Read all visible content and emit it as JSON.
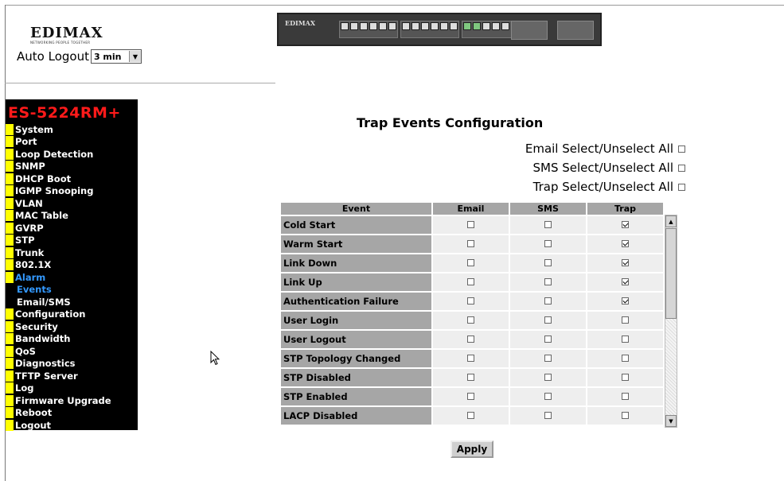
{
  "header": {
    "logo_text": "EDIMAX",
    "logo_tagline": "NETWORKING PEOPLE TOGETHER",
    "auto_logout_label": "Auto Logout",
    "auto_logout_value": "3 min",
    "device_brand": "EDIMAX"
  },
  "sidebar": {
    "model": "ES-5224RM+",
    "items": [
      {
        "label": "System"
      },
      {
        "label": "Port"
      },
      {
        "label": "Loop Detection"
      },
      {
        "label": "SNMP"
      },
      {
        "label": "DHCP Boot"
      },
      {
        "label": "IGMP Snooping"
      },
      {
        "label": "VLAN"
      },
      {
        "label": "MAC Table"
      },
      {
        "label": "GVRP"
      },
      {
        "label": "STP"
      },
      {
        "label": "Trunk"
      },
      {
        "label": "802.1X"
      },
      {
        "label": "Alarm"
      },
      {
        "label": "Events"
      },
      {
        "label": "Email/SMS"
      },
      {
        "label": "Configuration"
      },
      {
        "label": "Security"
      },
      {
        "label": "Bandwidth"
      },
      {
        "label": "QoS"
      },
      {
        "label": "Diagnostics"
      },
      {
        "label": "TFTP Server"
      },
      {
        "label": "Log"
      },
      {
        "label": "Firmware Upgrade"
      },
      {
        "label": "Reboot"
      },
      {
        "label": "Logout"
      }
    ]
  },
  "main": {
    "title": "Trap Events Configuration",
    "email_select_all": "Email Select/Unselect All",
    "sms_select_all": "SMS Select/Unselect All",
    "trap_select_all": "Trap Select/Unselect All",
    "columns": [
      "Event",
      "Email",
      "SMS",
      "Trap"
    ],
    "rows": [
      {
        "event": "Cold Start",
        "email": false,
        "sms": false,
        "trap": true
      },
      {
        "event": "Warm Start",
        "email": false,
        "sms": false,
        "trap": true
      },
      {
        "event": "Link Down",
        "email": false,
        "sms": false,
        "trap": true
      },
      {
        "event": "Link Up",
        "email": false,
        "sms": false,
        "trap": true
      },
      {
        "event": "Authentication Failure",
        "email": false,
        "sms": false,
        "trap": true
      },
      {
        "event": "User Login",
        "email": false,
        "sms": false,
        "trap": false
      },
      {
        "event": "User Logout",
        "email": false,
        "sms": false,
        "trap": false
      },
      {
        "event": "STP Topology Changed",
        "email": false,
        "sms": false,
        "trap": false
      },
      {
        "event": "STP Disabled",
        "email": false,
        "sms": false,
        "trap": false
      },
      {
        "event": "STP Enabled",
        "email": false,
        "sms": false,
        "trap": false
      },
      {
        "event": "LACP Disabled",
        "email": false,
        "sms": false,
        "trap": false
      }
    ],
    "apply_label": "Apply"
  }
}
